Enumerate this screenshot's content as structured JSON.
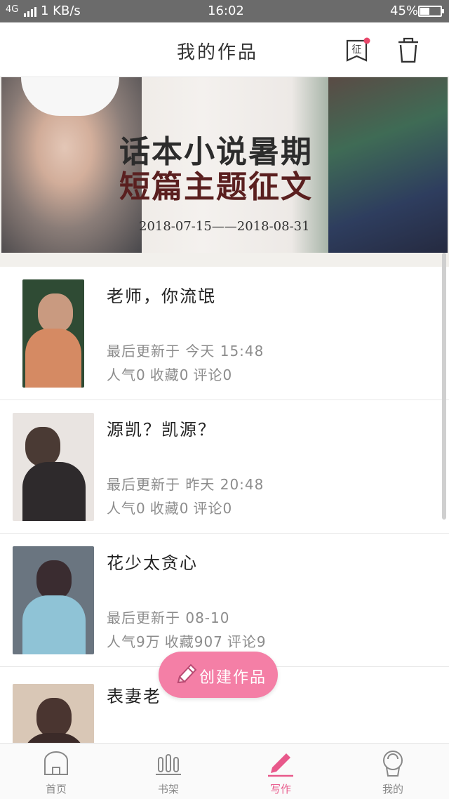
{
  "status_bar": {
    "network": "4G",
    "speed": "1 KB/s",
    "time": "16:02",
    "battery": "45%",
    "battery_level": 0.45
  },
  "header": {
    "title": "我的作品",
    "contest_icon_label": "征"
  },
  "banner": {
    "headline_line1": "话本小说暑期",
    "headline_line2": "短篇主题征文",
    "dates": "2018-07-15——2018-08-31"
  },
  "works": [
    {
      "title": "老师，你流氓",
      "updated": "最后更新于 今天 15:48",
      "popularity": "人气0",
      "favorites": "收藏0",
      "comments": "评论0"
    },
    {
      "title": "源凯？凯源？",
      "updated": "最后更新于 昨天 20:48",
      "popularity": "人气0",
      "favorites": "收藏0",
      "comments": "评论0"
    },
    {
      "title": "花少太贪心",
      "updated": "最后更新于 08-10",
      "popularity": "人气9万",
      "favorites": "收藏907",
      "comments": "评论9"
    },
    {
      "title": "表妻老",
      "updated": "",
      "popularity": "",
      "favorites": "",
      "comments": ""
    }
  ],
  "create_button": {
    "label": "创建作品"
  },
  "tabs": [
    {
      "label": "首页",
      "icon": "home-icon"
    },
    {
      "label": "书架",
      "icon": "bookshelf-icon"
    },
    {
      "label": "写作",
      "icon": "pencil-icon"
    },
    {
      "label": "我的",
      "icon": "profile-icon"
    }
  ],
  "active_tab": "写作",
  "colors": {
    "accent": "#e8598b",
    "create_button": "#f47fa6",
    "status_bar": "#6b6b6b",
    "muted_text": "#8c8c8c",
    "notification_dot": "#e8476a"
  }
}
